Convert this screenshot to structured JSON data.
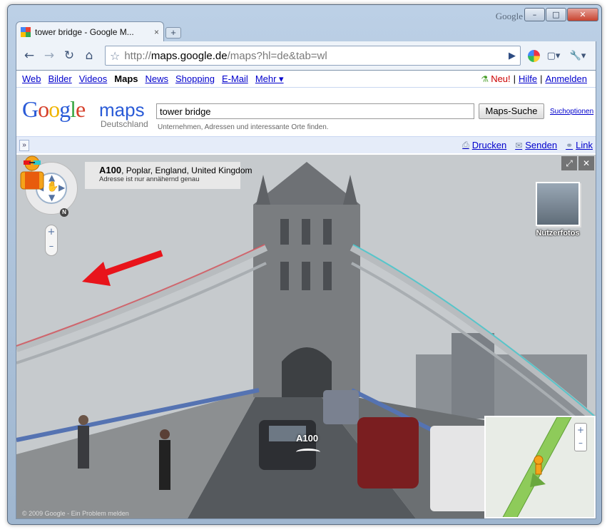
{
  "window": {
    "brand": "Google",
    "min_glyph": "–",
    "max_glyph": "□",
    "close_glyph": "✕"
  },
  "tab": {
    "title": "tower bridge - Google M...",
    "close_glyph": "×",
    "new_tab_glyph": "+"
  },
  "toolbar": {
    "back_glyph": "←",
    "forward_glyph": "→",
    "reload_glyph": "↻",
    "home_glyph": "⌂",
    "star_glyph": "☆",
    "url_prefix": "http://",
    "url_host": "maps.google.de",
    "url_path": "/maps?hl=de&tab=wl",
    "go_glyph": "▶",
    "page_menu_glyph": "▢▾",
    "wrench_glyph": "🔧▾"
  },
  "gbar": {
    "links": [
      "Web",
      "Bilder",
      "Videos",
      "Maps",
      "News",
      "Shopping",
      "E-Mail",
      "Mehr ▾"
    ],
    "current": "Maps",
    "new_label": "Neu!",
    "help": "Hilfe",
    "signin": "Anmelden"
  },
  "header": {
    "logo_text": "Google",
    "maps_word": "maps",
    "sub": "Deutschland",
    "search_value": "tower bridge",
    "search_button": "Maps-Suche",
    "search_options": "Suchoptionen",
    "hint": "Unternehmen, Adressen und interessante Orte finden."
  },
  "actionbar": {
    "collapse_glyph": "»",
    "print": "Drucken",
    "send": "Senden",
    "link": "Link"
  },
  "streetview": {
    "road": "A100",
    "address_rest": ", Poplar, England, United Kingdom",
    "approx_note": "Adresse ist nur annähernd genau",
    "compass": "N",
    "zoom_in": "+",
    "zoom_out": "–",
    "fullscreen_glyph": "⤢",
    "close_glyph": "✕",
    "user_photos": "Nutzerfotos",
    "copyright": "© 2009 Google - Ein Problem melden"
  },
  "colors": {
    "accent_link": "#0000cc",
    "arrow_red": "#e8141b",
    "minimap_road": "#8ecb5a"
  }
}
